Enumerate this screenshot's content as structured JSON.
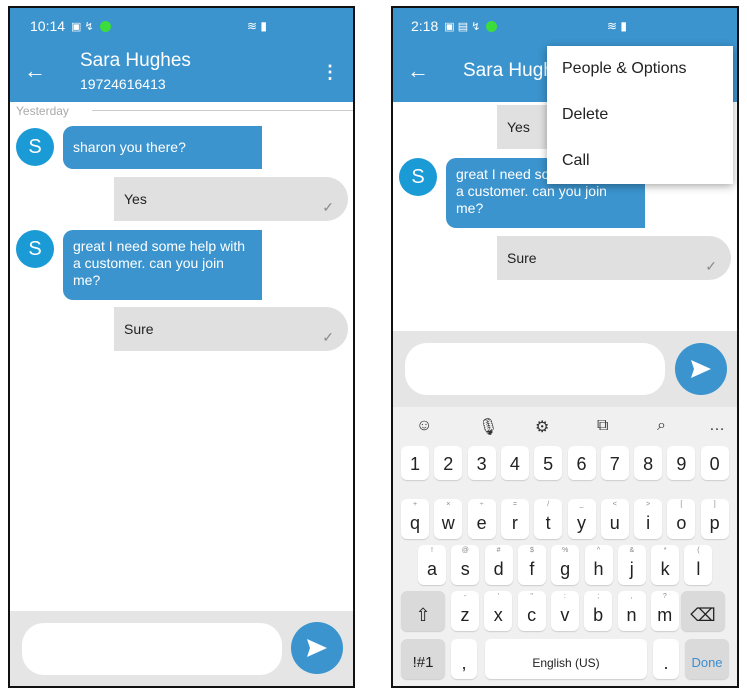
{
  "left": {
    "status": {
      "time": "10:14"
    },
    "header": {
      "back_icon": "arrow-left-icon",
      "name": "Sara Hughes",
      "phone": "19724616413",
      "menu_icon": "more-vertical-icon"
    },
    "date_divider": "Yesterday",
    "avatar_letter": "S",
    "messages": [
      {
        "dir": "in",
        "text": "sharon you there?"
      },
      {
        "dir": "out",
        "text": "Yes"
      },
      {
        "dir": "in",
        "text": "great I need some help with a customer. can you join me?"
      },
      {
        "dir": "out",
        "text": "Sure"
      }
    ],
    "send_icon": "send-icon"
  },
  "right": {
    "status": {
      "time": "2:18"
    },
    "header": {
      "name": "Sara Hughes"
    },
    "menu": [
      "People & Options",
      "Delete",
      "Call"
    ],
    "avatar_letter": "S",
    "messages": [
      {
        "dir": "out",
        "text": "Yes"
      },
      {
        "dir": "in",
        "text": "great I need some help with a customer. can you join me?"
      },
      {
        "dir": "out",
        "text": "Sure"
      }
    ],
    "keyboard": {
      "toolbar_icons": [
        "emoji-icon",
        "mic-icon",
        "settings-icon",
        "translate-icon",
        "search-icon",
        "more-horizontal-icon"
      ],
      "toolbar_more": "…",
      "numbers": [
        "1",
        "2",
        "3",
        "4",
        "5",
        "6",
        "7",
        "8",
        "9",
        "0"
      ],
      "row_q": [
        "q",
        "w",
        "e",
        "r",
        "t",
        "y",
        "u",
        "i",
        "o",
        "p"
      ],
      "row_q_sup": [
        "+",
        "×",
        "÷",
        "=",
        "/",
        "_",
        "<",
        ">",
        "[",
        "]"
      ],
      "row_a": [
        "a",
        "s",
        "d",
        "f",
        "g",
        "h",
        "j",
        "k",
        "l"
      ],
      "row_a_sup": [
        "!",
        "@",
        "#",
        "$",
        "%",
        "^",
        "&",
        "*",
        "("
      ],
      "row_z": [
        "z",
        "x",
        "c",
        "v",
        "b",
        "n",
        "m"
      ],
      "row_z_sup": [
        "-",
        "'",
        "\"",
        ":",
        ";",
        ",",
        "?"
      ],
      "shift": "⇧",
      "backspace": "⌫",
      "symbols": "!#1",
      "comma": ",",
      "space": "English (US)",
      "period": ".",
      "done": "Done"
    }
  }
}
